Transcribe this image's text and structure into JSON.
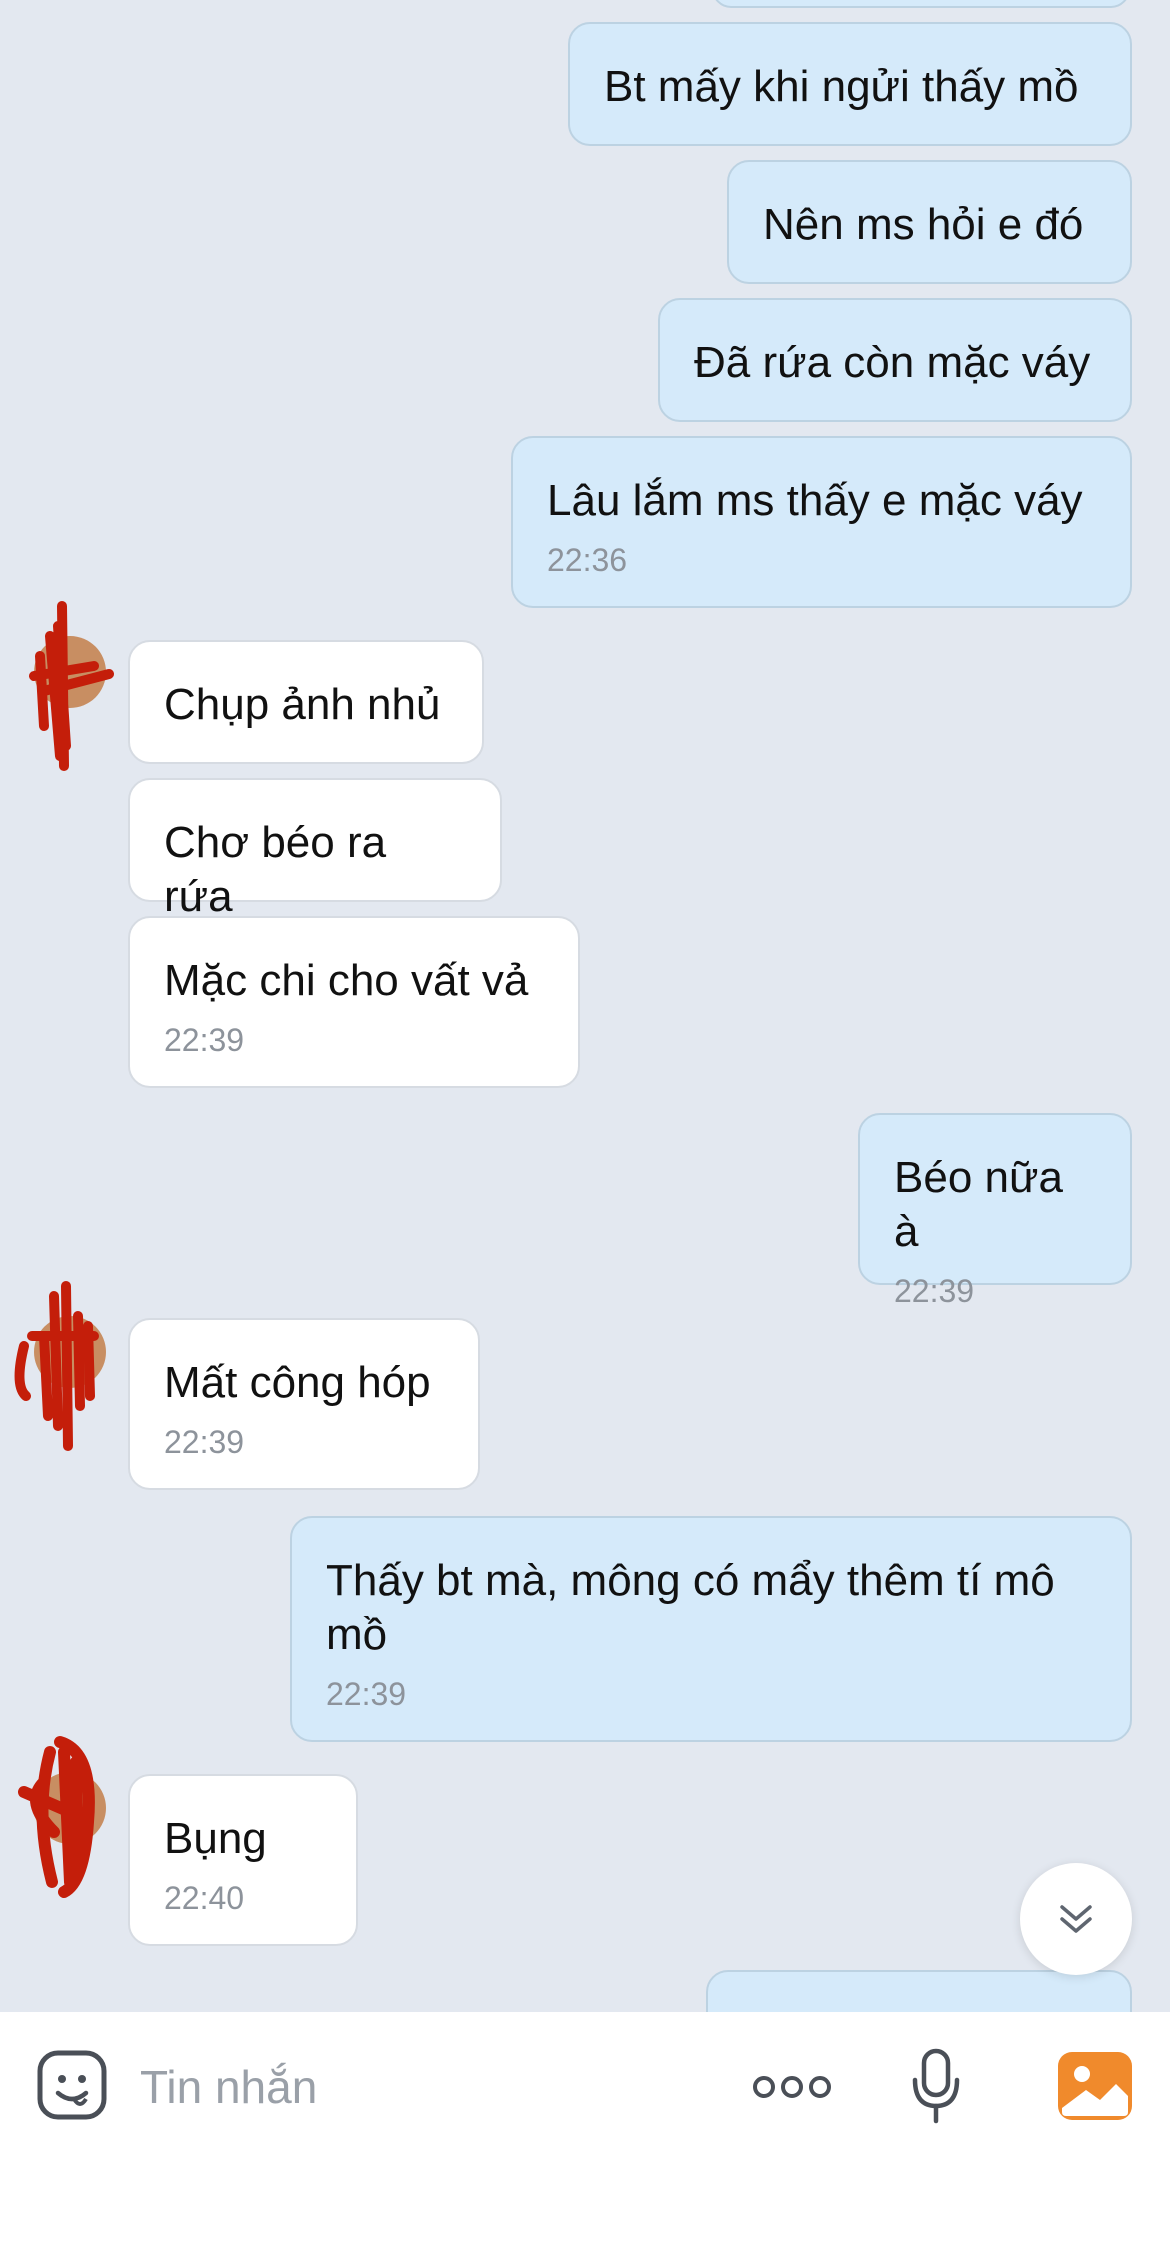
{
  "messages": [
    {
      "text": "Bt mấy khi ngửi thấy mồ"
    },
    {
      "text": "Nên ms hỏi e đó"
    },
    {
      "text": "Đã rứa còn mặc váy"
    },
    {
      "text": "Lâu lắm ms thấy e mặc váy",
      "time": "22:36"
    },
    {
      "text": "Chụp ảnh nhủ"
    },
    {
      "text": "Chơ béo ra rứa"
    },
    {
      "text": "Mặc chi cho vất vả",
      "time": "22:39"
    },
    {
      "text": "Béo nữa à",
      "time": "22:39"
    },
    {
      "text": "Mất công hóp",
      "time": "22:39"
    },
    {
      "text": "Thấy bt mà, mông có mẩy thêm tí mô mồ",
      "time": "22:39"
    },
    {
      "text": "Bụng",
      "time": "22:40"
    }
  ],
  "input": {
    "placeholder": "Tin nhắn"
  },
  "icons": {
    "sticker": "sticker-face-icon",
    "more": "more-options-icon",
    "mic": "microphone-icon",
    "image": "image-gallery-icon",
    "scroll": "scroll-down-chevron-icon"
  },
  "colors": {
    "chat_background": "#e3e8f0",
    "outgoing_bubble": "#d5eafa",
    "incoming_bubble": "#ffffff",
    "timestamp": "#8d939b",
    "image_icon": "#f08a2c",
    "redaction_scribble": "#c41e0a"
  }
}
